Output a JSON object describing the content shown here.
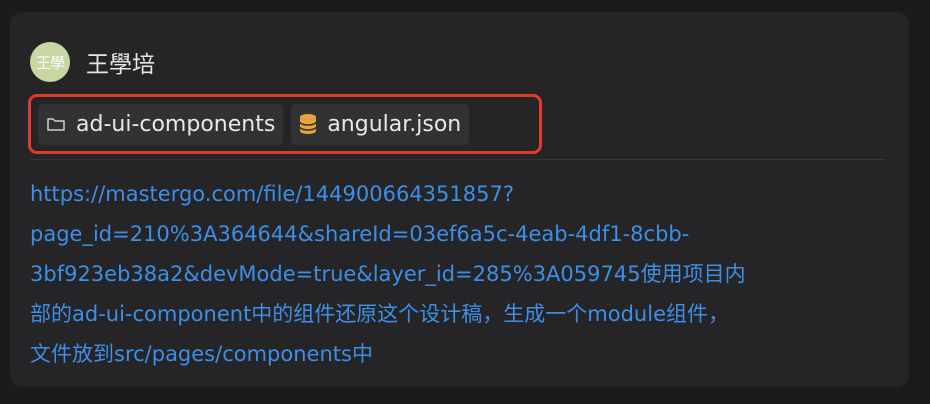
{
  "user": {
    "avatar_text": "王學",
    "name": "王學培"
  },
  "context_chips": [
    {
      "label": "ad-ui-components",
      "icon": "folder-icon"
    },
    {
      "label": "angular.json",
      "icon": "database-icon"
    }
  ],
  "message": {
    "lines": [
      "https://mastergo.com/file/144900664351857?",
      "page_id=210%3A364644&shareId=03ef6a5c-4eab-4df1-8cbb-",
      "3bf923eb38a2&devMode=true&layer_id=285%3A059745使用项目内",
      "部的ad-ui-component中的组件还原这个设计稿，生成一个module组件，",
      "文件放到src/pages/components中"
    ]
  },
  "colors": {
    "background": "#1b1b1d",
    "card": "#252527",
    "chip": "#323235",
    "highlight_border": "#e23b2e",
    "link": "#3d8fe6",
    "db_icon": "#e9a43c"
  }
}
